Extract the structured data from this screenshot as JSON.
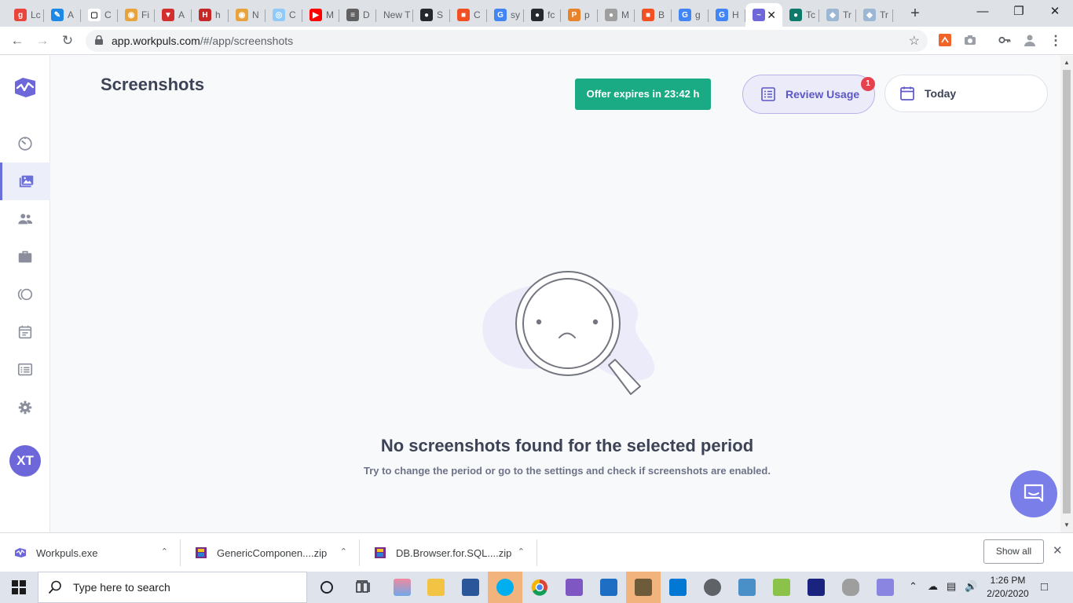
{
  "browser": {
    "tabs": [
      {
        "label": "Lc",
        "color": "#e8453c",
        "glyph": "g"
      },
      {
        "label": "A",
        "color": "#1e88e5",
        "glyph": "✎"
      },
      {
        "label": "C",
        "color": "#ffffff",
        "glyph": "▢"
      },
      {
        "label": "Fi",
        "color": "#e9a33c",
        "glyph": "◉"
      },
      {
        "label": "A",
        "color": "#d32f2f",
        "glyph": "▼"
      },
      {
        "label": "h",
        "color": "#c62828",
        "glyph": "H"
      },
      {
        "label": "N",
        "color": "#e9a33c",
        "glyph": "◉"
      },
      {
        "label": "C",
        "color": "#90caf9",
        "glyph": "◎"
      },
      {
        "label": "M",
        "color": "#ff0000",
        "glyph": "▶"
      },
      {
        "label": "D",
        "color": "#616161",
        "glyph": "≡"
      },
      {
        "label": "New T",
        "color": "",
        "glyph": ""
      },
      {
        "label": "S",
        "color": "#24292e",
        "glyph": "●"
      },
      {
        "label": "C",
        "color": "#f25022",
        "glyph": "■"
      },
      {
        "label": "sy",
        "color": "#4285f4",
        "glyph": "G"
      },
      {
        "label": "fc",
        "color": "#24292e",
        "glyph": "●"
      },
      {
        "label": "p",
        "color": "#e8822b",
        "glyph": "P"
      },
      {
        "label": "M",
        "color": "#9e9e9e",
        "glyph": "●"
      },
      {
        "label": "B",
        "color": "#f25022",
        "glyph": "■"
      },
      {
        "label": "g",
        "color": "#4285f4",
        "glyph": "G"
      },
      {
        "label": "H",
        "color": "#4285f4",
        "glyph": "G"
      },
      {
        "label": "",
        "color": "#6d67d9",
        "glyph": "~"
      },
      {
        "label": "Tc",
        "color": "#0b7a6a",
        "glyph": "●"
      },
      {
        "label": "Tr",
        "color": "#9bb7d4",
        "glyph": "◆"
      },
      {
        "label": "Tr",
        "color": "#9bb7d4",
        "glyph": "◆"
      }
    ],
    "active_tab_index": 20,
    "url_host": "app.workpuls.com",
    "url_path": "/#/app/screenshots"
  },
  "sidebar": {
    "items": [
      {
        "name": "timer-icon"
      },
      {
        "name": "screenshots-icon"
      },
      {
        "name": "people-icon"
      },
      {
        "name": "briefcase-icon"
      },
      {
        "name": "productivity-icon"
      },
      {
        "name": "calendar-icon"
      },
      {
        "name": "reports-icon"
      },
      {
        "name": "gear-icon"
      }
    ],
    "active_index": 1,
    "avatar_initials": "XT"
  },
  "header": {
    "title": "Screenshots",
    "offer": "Offer expires in 23:42 h",
    "review_label": "Review Usage",
    "review_badge": "1",
    "date_label": "Today"
  },
  "empty_state": {
    "title": "No screenshots found for the selected period",
    "subtitle": "Try to change the period or go to the settings and check if screenshots are enabled."
  },
  "downloads": {
    "items": [
      {
        "name": "Workpuls.exe"
      },
      {
        "name": "GenericComponen....zip"
      },
      {
        "name": "DB.Browser.for.SQL....zip"
      }
    ],
    "show_all": "Show all"
  },
  "taskbar": {
    "search_placeholder": "Type here to search",
    "time": "1:26 PM",
    "date": "2/20/2020"
  },
  "colors": {
    "accent": "#6b6fdc",
    "offer_green": "#1aaa84",
    "badge_red": "#e5424d"
  }
}
